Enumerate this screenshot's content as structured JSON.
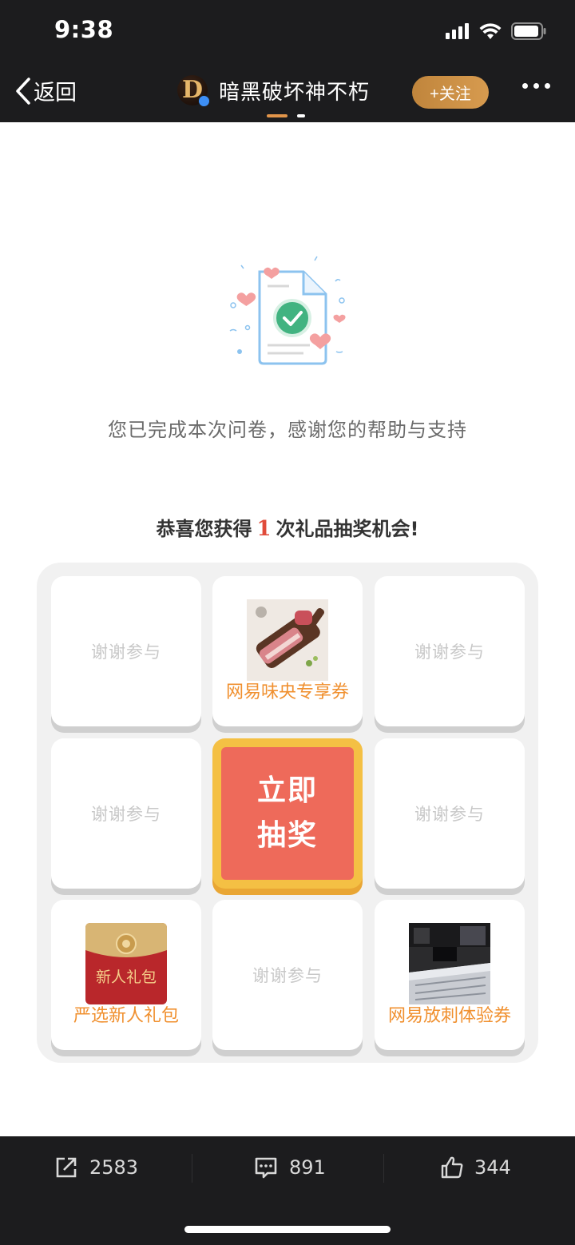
{
  "status": {
    "time": "9:38"
  },
  "nav": {
    "back_label": "返回",
    "avatar_letter": "D",
    "title": "暗黑破坏神不朽",
    "follow_label": "+关注"
  },
  "survey": {
    "complete_text": "您已完成本次问卷，感谢您的帮助与支持",
    "congrats_prefix": "恭喜您获得",
    "chances": "1",
    "congrats_suffix": "次礼品抽奖机会!"
  },
  "lottery": {
    "draw_label": "立即抽奖",
    "thanks_label": "谢谢参与",
    "prizes": {
      "top_middle": "网易味央专享券",
      "bottom_left": "严选新人礼包",
      "bottom_left_image_text": "新人礼包",
      "bottom_right": "网易放刺体验券"
    }
  },
  "actions": {
    "share_count": "2583",
    "comment_count": "891",
    "like_count": "344"
  },
  "colors": {
    "accent_orange": "#f0902f",
    "draw_red": "#ee6a5a",
    "draw_border": "#f4c044",
    "follow_gold": "#c98c42",
    "dark_bar": "#1c1c1e"
  }
}
